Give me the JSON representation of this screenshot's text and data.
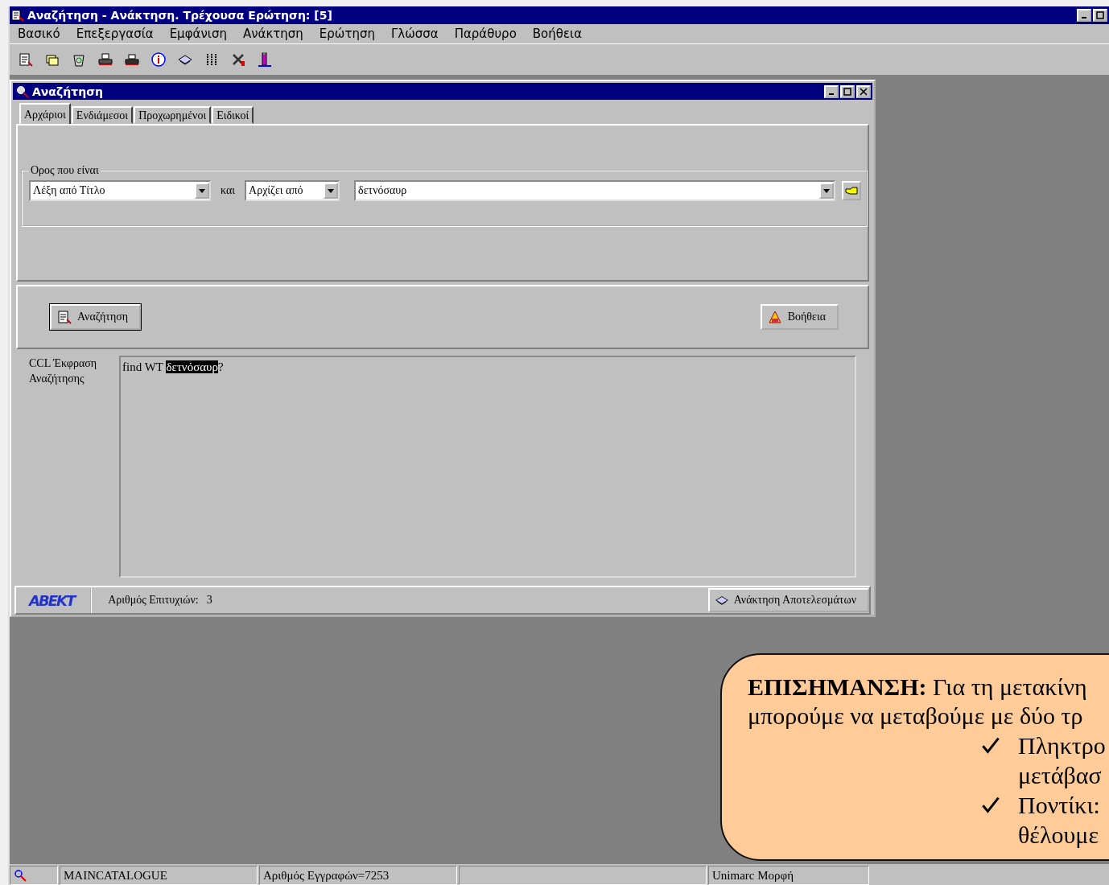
{
  "app_window": {
    "title": "Αναζήτηση - Ανάκτηση. Τρέχουσα Ερώτηση: [5]"
  },
  "menu": [
    "Βασικό",
    "Επεξεργασία",
    "Εμφάνιση",
    "Ανάκτηση",
    "Ερώτηση",
    "Γλώσσα",
    "Παράθυρο",
    "Βοήθεια"
  ],
  "search_window": {
    "title": "Αναζήτηση",
    "tabs": [
      {
        "label": "Αρχάριοι",
        "selected": true
      },
      {
        "label": "Ενδιάμεσοι",
        "selected": false
      },
      {
        "label": "Προχωρημένοι",
        "selected": false
      },
      {
        "label": "Ειδικοί",
        "selected": false
      }
    ],
    "term_group": {
      "legend": "Ορος που είναι",
      "field": "Λέξη από Τίτλο",
      "connector": "και",
      "operator": "Αρχίζει από",
      "value": "δετνόσαυρ"
    },
    "buttons": [
      {
        "label": "Αναζήτηση"
      },
      {
        "label": "Βοήθεια"
      }
    ],
    "ccl": {
      "label": "CCL Έκφραση Αναζήτησης",
      "text_before": "find WT ",
      "selected_text": "δετνόσαυρ",
      "text_after": "?"
    },
    "footer": {
      "logo": "ABEKT",
      "hits_label": "Αριθμός Επιτυχιών:",
      "hits": "3",
      "results_button": "Ανάκτηση Αποτελεσμάτων"
    }
  },
  "status_bar": [
    "MAINCATALOGUE",
    "Αριθμός Εγγραφών=7253",
    "Unimarc Μορφή"
  ],
  "callout": {
    "lines": [
      "**ΕΠΙΣΗΜΑΝΣΗ:** Για τη μετακίνη",
      "μπορούμε να μεταβούμε με δύο τρ"
    ],
    "bullets": [
      {
        "lines": [
          "Πληκτρο",
          "μετάβασ"
        ]
      },
      {
        "lines": [
          "Ποντίκι:",
          "θέλουμε"
        ]
      }
    ]
  }
}
